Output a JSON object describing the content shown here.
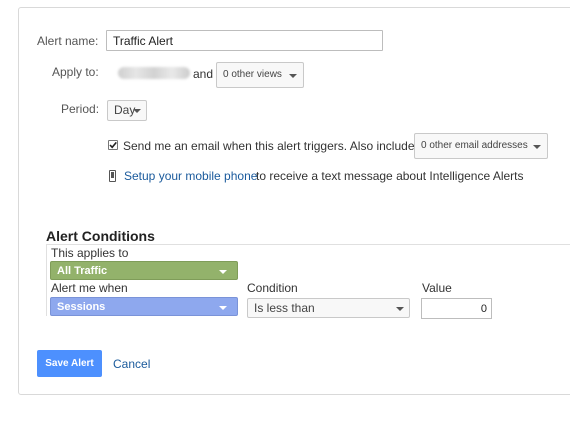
{
  "alert_name": {
    "label": "Alert name:",
    "value": "Traffic Alert"
  },
  "apply_to": {
    "label": "Apply to:",
    "and_text": "and",
    "views_dropdown": "0 other views"
  },
  "period": {
    "label": "Period:",
    "selected": "Day"
  },
  "email": {
    "checked": true,
    "text": "Send me an email when this alert triggers. Also include",
    "addresses_dropdown": "0 other email addresses"
  },
  "mobile": {
    "link_text": "Setup your mobile phone",
    "suffix": "to receive a text message about Intelligence Alerts"
  },
  "conditions": {
    "title": "Alert Conditions",
    "applies_to_label": "This applies to",
    "applies_to_value": "All Traffic",
    "alert_when_label": "Alert me when",
    "alert_when_value": "Sessions",
    "condition_label": "Condition",
    "condition_value": "Is less than",
    "value_label": "Value",
    "value": "0"
  },
  "actions": {
    "save_label": "Save Alert",
    "cancel_label": "Cancel"
  },
  "colors": {
    "segment_green": "#93b26b",
    "metric_blue": "#8ea8ee",
    "primary_blue": "#4d90fe",
    "link_blue": "#1a5a9c"
  }
}
